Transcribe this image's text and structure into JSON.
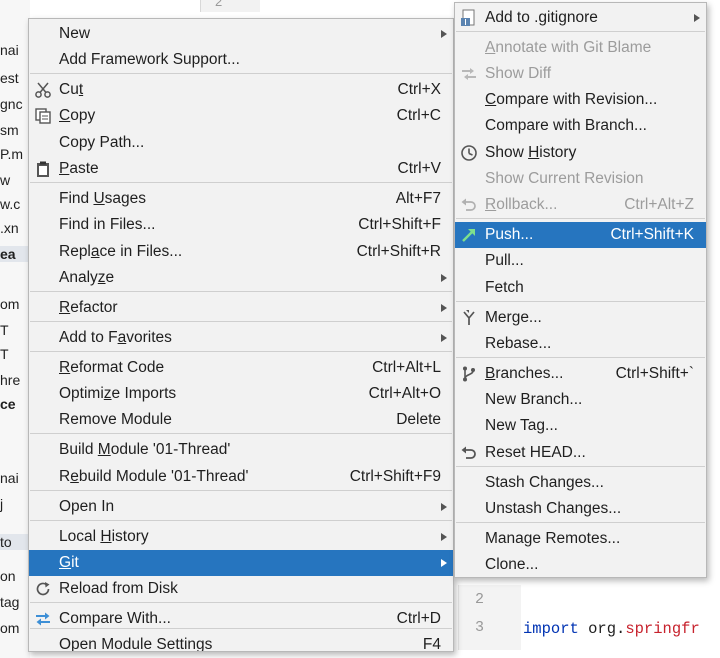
{
  "background": {
    "left_fragments": [
      "nai",
      "est",
      "gnc",
      "sm",
      "P.m",
      "w",
      "w.c",
      ".xn",
      "ea",
      "om",
      "T",
      "T",
      "hre",
      "ce",
      "nai",
      "j",
      "to",
      "on",
      "tag",
      "om"
    ],
    "line_numbers": [
      "2",
      "2",
      "3"
    ],
    "code_line": {
      "keyword": "import",
      "text_plain": " org.",
      "text_highlight": "springfr"
    },
    "top_line_number": "2"
  },
  "context_menu": {
    "items": [
      {
        "label_pre": "New",
        "label_u": "",
        "label_post": "",
        "shortcut": "",
        "submenu": true,
        "icon": ""
      },
      {
        "label_pre": "Add Framework Support...",
        "label_u": "",
        "label_post": "",
        "shortcut": "",
        "submenu": false,
        "icon": ""
      },
      {
        "label_pre": "Cu",
        "label_u": "t",
        "label_post": "",
        "shortcut": "Ctrl+X",
        "submenu": false,
        "icon": "scissors-icon"
      },
      {
        "label_pre": "",
        "label_u": "C",
        "label_post": "opy",
        "shortcut": "Ctrl+C",
        "submenu": false,
        "icon": "copy-icon"
      },
      {
        "label_pre": "Copy Path...",
        "label_u": "",
        "label_post": "",
        "shortcut": "",
        "submenu": false,
        "icon": ""
      },
      {
        "label_pre": "",
        "label_u": "P",
        "label_post": "aste",
        "shortcut": "Ctrl+V",
        "submenu": false,
        "icon": "clipboard-icon"
      },
      {
        "label_pre": "Find ",
        "label_u": "U",
        "label_post": "sages",
        "shortcut": "Alt+F7",
        "submenu": false,
        "icon": ""
      },
      {
        "label_pre": "Find in Files...",
        "label_u": "",
        "label_post": "",
        "shortcut": "Ctrl+Shift+F",
        "submenu": false,
        "icon": ""
      },
      {
        "label_pre": "Repl",
        "label_u": "a",
        "label_post": "ce in Files...",
        "shortcut": "Ctrl+Shift+R",
        "submenu": false,
        "icon": ""
      },
      {
        "label_pre": "Analy",
        "label_u": "z",
        "label_post": "e",
        "shortcut": "",
        "submenu": true,
        "icon": ""
      },
      {
        "label_pre": "",
        "label_u": "R",
        "label_post": "efactor",
        "shortcut": "",
        "submenu": true,
        "icon": ""
      },
      {
        "label_pre": "Add to F",
        "label_u": "a",
        "label_post": "vorites",
        "shortcut": "",
        "submenu": true,
        "icon": ""
      },
      {
        "label_pre": "",
        "label_u": "R",
        "label_post": "eformat Code",
        "shortcut": "Ctrl+Alt+L",
        "submenu": false,
        "icon": ""
      },
      {
        "label_pre": "Optimi",
        "label_u": "z",
        "label_post": "e Imports",
        "shortcut": "Ctrl+Alt+O",
        "submenu": false,
        "icon": ""
      },
      {
        "label_pre": "Remove Module",
        "label_u": "",
        "label_post": "",
        "shortcut": "Delete",
        "submenu": false,
        "icon": ""
      },
      {
        "label_pre": "Build ",
        "label_u": "M",
        "label_post": "odule '01-Thread'",
        "shortcut": "",
        "submenu": false,
        "icon": ""
      },
      {
        "label_pre": "R",
        "label_u": "e",
        "label_post": "build Module '01-Thread'",
        "shortcut": "Ctrl+Shift+F9",
        "submenu": false,
        "icon": ""
      },
      {
        "label_pre": "Open In",
        "label_u": "",
        "label_post": "",
        "shortcut": "",
        "submenu": true,
        "icon": ""
      },
      {
        "label_pre": "Local ",
        "label_u": "H",
        "label_post": "istory",
        "shortcut": "",
        "submenu": true,
        "icon": ""
      },
      {
        "label_pre": "",
        "label_u": "G",
        "label_post": "it",
        "shortcut": "",
        "submenu": true,
        "icon": ""
      },
      {
        "label_pre": "Reload from Disk",
        "label_u": "",
        "label_post": "",
        "shortcut": "",
        "submenu": false,
        "icon": "reload-icon"
      },
      {
        "label_pre": "Compare With...",
        "label_u": "",
        "label_post": "",
        "shortcut": "Ctrl+D",
        "submenu": false,
        "icon": "compare-icon"
      },
      {
        "label_pre": "Open Module Settings",
        "label_u": "",
        "label_post": "",
        "shortcut": "F4",
        "submenu": false,
        "icon": ""
      }
    ]
  },
  "git_menu": {
    "items": [
      {
        "label_pre": "Add to .gitignore",
        "label_u": "",
        "label_post": "",
        "shortcut": "",
        "submenu": true,
        "icon": "gitignore-icon"
      },
      {
        "label_pre": "",
        "label_u": "A",
        "label_post": "nnotate with Git Blame",
        "shortcut": "",
        "submenu": false,
        "icon": ""
      },
      {
        "label_pre": "Show Diff",
        "label_u": "",
        "label_post": "",
        "shortcut": "",
        "submenu": false,
        "icon": "diff-icon"
      },
      {
        "label_pre": "",
        "label_u": "C",
        "label_post": "ompare with Revision...",
        "shortcut": "",
        "submenu": false,
        "icon": ""
      },
      {
        "label_pre": "Compare with Branch...",
        "label_u": "",
        "label_post": "",
        "shortcut": "",
        "submenu": false,
        "icon": ""
      },
      {
        "label_pre": "Show ",
        "label_u": "H",
        "label_post": "istory",
        "shortcut": "",
        "submenu": false,
        "icon": "history-icon"
      },
      {
        "label_pre": "Show Current Revision",
        "label_u": "",
        "label_post": "",
        "shortcut": "",
        "submenu": false,
        "icon": ""
      },
      {
        "label_pre": "",
        "label_u": "R",
        "label_post": "ollback...",
        "shortcut": "Ctrl+Alt+Z",
        "submenu": false,
        "icon": "rollback-icon"
      },
      {
        "label_pre": "Push...",
        "label_u": "",
        "label_post": "",
        "shortcut": "Ctrl+Shift+K",
        "submenu": false,
        "icon": "push-arrow-icon"
      },
      {
        "label_pre": "Pull...",
        "label_u": "",
        "label_post": "",
        "shortcut": "",
        "submenu": false,
        "icon": ""
      },
      {
        "label_pre": "Fetch",
        "label_u": "",
        "label_post": "",
        "shortcut": "",
        "submenu": false,
        "icon": ""
      },
      {
        "label_pre": "Merge...",
        "label_u": "",
        "label_post": "",
        "shortcut": "",
        "submenu": false,
        "icon": "merge-icon"
      },
      {
        "label_pre": "Rebase...",
        "label_u": "",
        "label_post": "",
        "shortcut": "",
        "submenu": false,
        "icon": ""
      },
      {
        "label_pre": "",
        "label_u": "B",
        "label_post": "ranches...",
        "shortcut": "Ctrl+Shift+`",
        "submenu": false,
        "icon": "branch-icon"
      },
      {
        "label_pre": "New Branch...",
        "label_u": "",
        "label_post": "",
        "shortcut": "",
        "submenu": false,
        "icon": ""
      },
      {
        "label_pre": "New Tag...",
        "label_u": "",
        "label_post": "",
        "shortcut": "",
        "submenu": false,
        "icon": ""
      },
      {
        "label_pre": "Reset HEAD...",
        "label_u": "",
        "label_post": "",
        "shortcut": "",
        "submenu": false,
        "icon": "reset-icon"
      },
      {
        "label_pre": "Stash Changes...",
        "label_u": "",
        "label_post": "",
        "shortcut": "",
        "submenu": false,
        "icon": ""
      },
      {
        "label_pre": "Unstash Changes...",
        "label_u": "",
        "label_post": "",
        "shortcut": "",
        "submenu": false,
        "icon": ""
      },
      {
        "label_pre": "Manage Remotes...",
        "label_u": "",
        "label_post": "",
        "shortcut": "",
        "submenu": false,
        "icon": ""
      },
      {
        "label_pre": "Clone...",
        "label_u": "",
        "label_post": "",
        "shortcut": "",
        "submenu": false,
        "icon": ""
      }
    ]
  },
  "colors": {
    "selection": "#2675bf",
    "menu_bg": "#f2f2f2",
    "disabled_text": "#9c9c9c",
    "push_icon": "#3a9a4a",
    "keyword": "#0033b3",
    "highlight": "#c7222d"
  }
}
